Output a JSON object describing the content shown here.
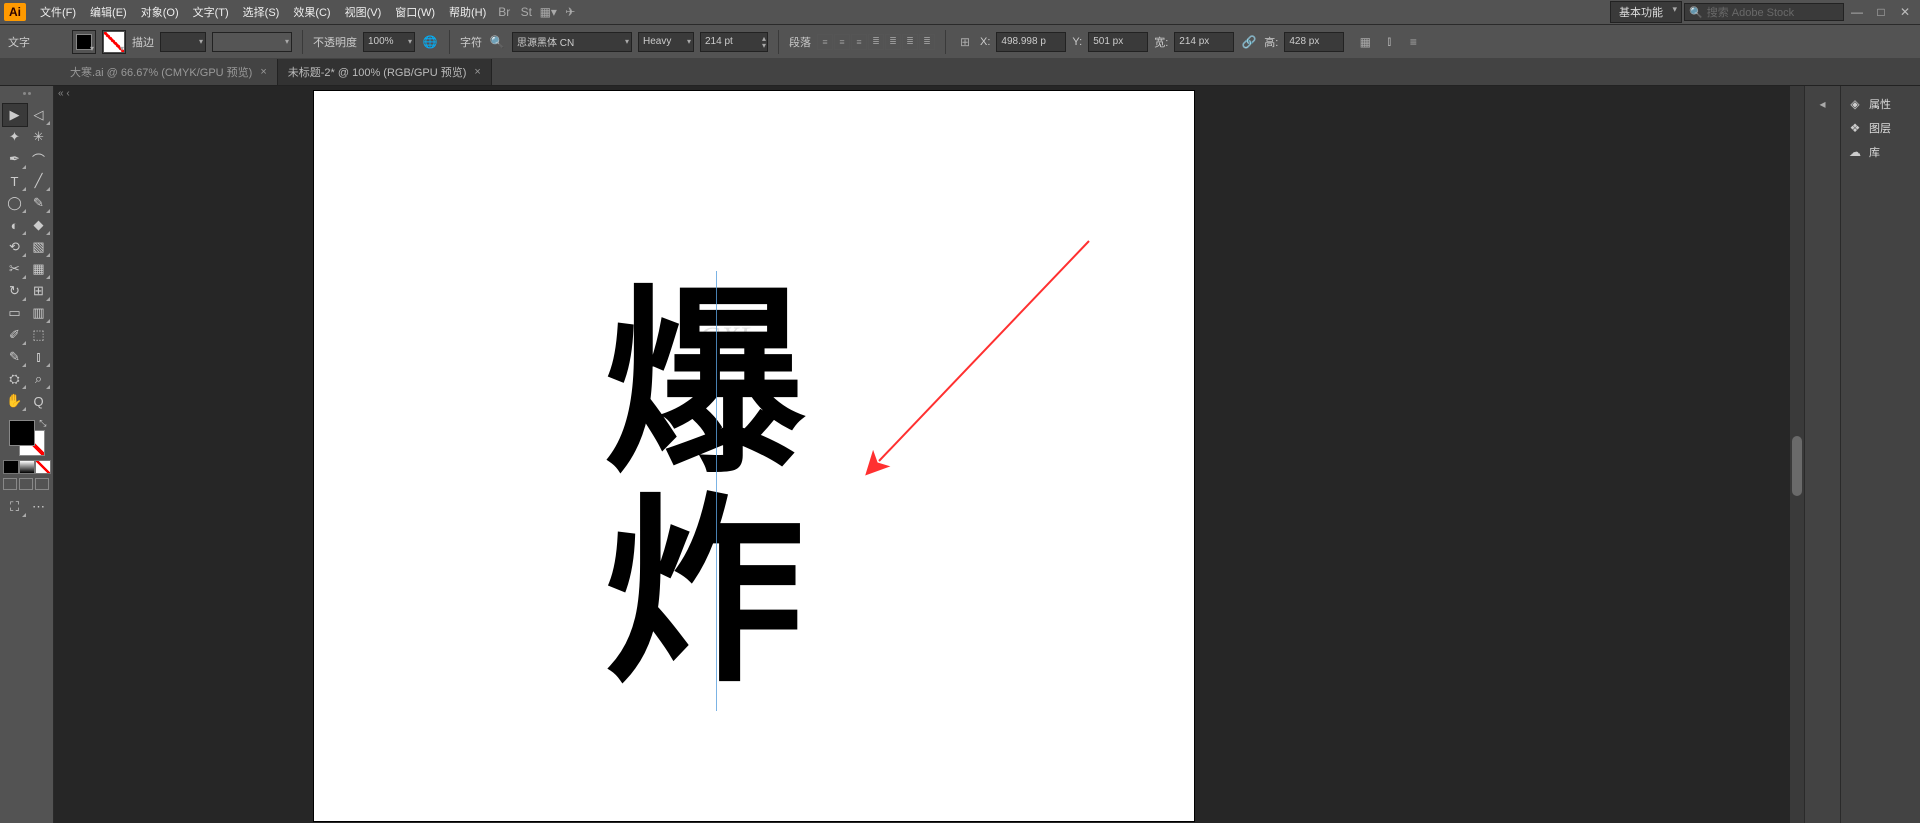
{
  "menubar": {
    "logo": "Ai",
    "items": [
      "文件(F)",
      "编辑(E)",
      "对象(O)",
      "文字(T)",
      "选择(S)",
      "效果(C)",
      "视图(V)",
      "窗口(W)",
      "帮助(H)"
    ],
    "workspace": "基本功能",
    "search_placeholder": "搜索 Adobe Stock"
  },
  "controlbar": {
    "tool_label": "文字",
    "stroke_label": "描边",
    "stroke_weight": "",
    "opacity_label": "不透明度",
    "opacity_value": "100%",
    "char_label": "字符",
    "font_family": "思源黑体 CN",
    "font_weight": "Heavy",
    "font_size": "214 pt",
    "para_label": "段落",
    "x_label": "X:",
    "x_value": "498.998 p",
    "y_label": "Y:",
    "y_value": "501 px",
    "w_label": "宽:",
    "w_value": "214 px",
    "h_label": "高:",
    "h_value": "428 px"
  },
  "tabs": [
    {
      "title": "大寒.ai @ 66.67% (CMYK/GPU 预览)",
      "active": false
    },
    {
      "title": "未标题-2* @ 100% (RGB/GPU 预览)",
      "active": true
    }
  ],
  "canvas": {
    "text_line1": "爆",
    "text_line2": "炸",
    "watermark": "GXL"
  },
  "rightpanel": {
    "items": [
      {
        "icon": "◈",
        "label": "属性"
      },
      {
        "icon": "❖",
        "label": "图层"
      },
      {
        "icon": "☁",
        "label": "库"
      }
    ]
  },
  "tools_left": [
    [
      "▶",
      "◁"
    ],
    [
      "✦",
      "✳"
    ],
    [
      "✒",
      "⌒"
    ],
    [
      "T",
      "╱"
    ],
    [
      "◯",
      "✎"
    ],
    [
      "◐",
      "◆"
    ],
    [
      "⟲",
      "▧"
    ],
    [
      "✂",
      "▦"
    ],
    [
      "↻",
      "⊞"
    ],
    [
      "▭",
      "▥"
    ],
    [
      "✐",
      "⬚"
    ],
    [
      "✎",
      "⫾"
    ],
    [
      "⛭",
      "⌕"
    ],
    [
      "✋",
      "Q"
    ]
  ],
  "window_controls": {
    "min": "—",
    "max": "□",
    "close": "✕"
  }
}
